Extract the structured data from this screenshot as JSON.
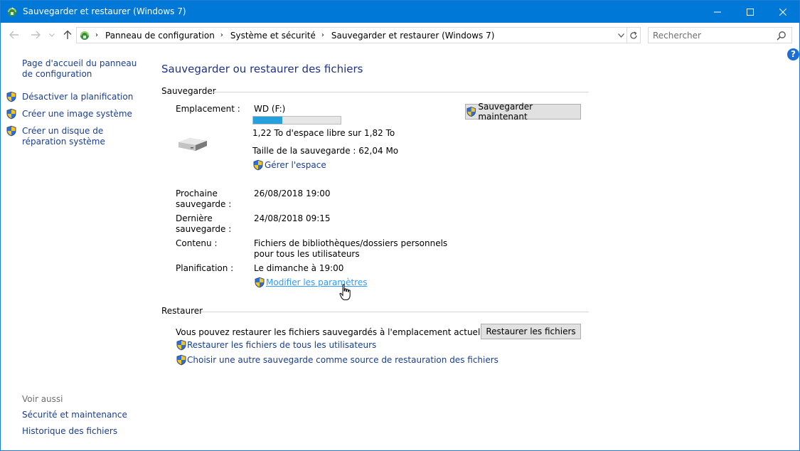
{
  "window": {
    "title": "Sauvegarder et restaurer (Windows 7)"
  },
  "address": {
    "crumbs": [
      "Panneau de configuration",
      "Système et sécurité",
      "Sauvegarder et restaurer (Windows 7)"
    ]
  },
  "search": {
    "placeholder": "Rechercher"
  },
  "help_label": "?",
  "sidebar": {
    "home_link": "Page d'accueil du panneau de configuration",
    "tasks": [
      {
        "label": "Désactiver la planification"
      },
      {
        "label": "Créer une image système"
      },
      {
        "label": "Créer un disque de réparation système"
      }
    ],
    "see_also_title": "Voir aussi",
    "see_also": [
      {
        "label": "Sécurité et maintenance"
      },
      {
        "label": "Historique des fichiers"
      }
    ]
  },
  "main": {
    "title": "Sauvegarder ou restaurer des fichiers",
    "backup": {
      "section_label": "Sauvegarder",
      "location_label": "Emplacement :",
      "drive_name": "WD (F:)",
      "free_space": "1,22 To d'espace libre sur 1,82 To",
      "used_fraction": 0.33,
      "backup_size": "Taille de la sauvegarde : 62,04 Mo",
      "manage_space_link": "Gérer l'espace",
      "backup_now_button": "Sauvegarder maintenant",
      "next_backup_label": "Prochaine sauvegarde :",
      "next_backup_value": "26/08/2018 19:00",
      "last_backup_label": "Dernière sauvegarde :",
      "last_backup_value": "24/08/2018 09:15",
      "contents_label": "Contenu :",
      "contents_value": "Fichiers de bibliothèques/dossiers personnels pour tous les utilisateurs",
      "schedule_label": "Planification :",
      "schedule_value": "Le dimanche à 19:00",
      "change_settings_link": "Modifier les paramètres"
    },
    "restore": {
      "section_label": "Restaurer",
      "description": "Vous pouvez restaurer les fichiers sauvegardés à l'emplacement actuel.",
      "restore_button": "Restaurer les fichiers",
      "restore_all_users_link": "Restaurer les fichiers de tous les utilisateurs",
      "choose_other_backup_link": "Choisir une autre sauvegarde comme source de restauration des fichiers"
    }
  },
  "colors": {
    "titlebar": "#0078d7",
    "link": "#1a3e8e",
    "heading": "#1e3287",
    "progress_fill": "#26a0da"
  }
}
